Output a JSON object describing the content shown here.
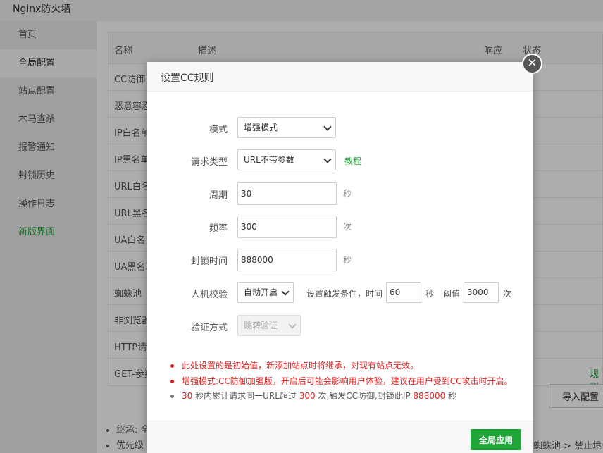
{
  "app": {
    "title": "Nginx防火墙"
  },
  "sidebar": {
    "items": [
      {
        "label": "首页"
      },
      {
        "label": "全局配置"
      },
      {
        "label": "站点配置"
      },
      {
        "label": "木马查杀"
      },
      {
        "label": "报警通知"
      },
      {
        "label": "封锁历史"
      },
      {
        "label": "操作日志"
      },
      {
        "label": "新版界面"
      }
    ]
  },
  "table": {
    "headers": {
      "name": "名称",
      "desc": "描述",
      "response": "响应",
      "status": "状态"
    },
    "rows": [
      {
        "name": "CC防御"
      },
      {
        "name": "恶意容忍"
      },
      {
        "name": "IP白名单"
      },
      {
        "name": "IP黑名单"
      },
      {
        "name": "URL白名单"
      },
      {
        "name": "URL黑名单"
      },
      {
        "name": "UA白名单"
      },
      {
        "name": "UA黑名单"
      },
      {
        "name": "蜘蛛池"
      },
      {
        "name": "非浏览器"
      },
      {
        "name": "HTTP请求"
      },
      {
        "name": "GET-参数"
      }
    ],
    "row_link": "规则",
    "import_label": "导入配置"
  },
  "notes": {
    "items": [
      "继承: 全",
      "优先级"
    ],
    "trail": "蜘蛛池 > 禁止境外"
  },
  "modal": {
    "title": "设置CC规则",
    "close_symbol": "✕",
    "mode": {
      "label": "模式",
      "value": "增强模式"
    },
    "request_type": {
      "label": "请求类型",
      "value": "URL不带参数",
      "tutorial": "教程"
    },
    "period": {
      "label": "周期",
      "value": "30",
      "unit": "秒"
    },
    "frequency": {
      "label": "频率",
      "value": "300",
      "unit": "次"
    },
    "ban_time": {
      "label": "封锁时间",
      "value": "888000",
      "unit": "秒"
    },
    "captcha": {
      "label": "人机校验",
      "value": "自动开启",
      "trigger_prefix": "设置触发条件，时间",
      "time_value": "60",
      "time_unit": "秒",
      "threshold_label": "阈值",
      "threshold_value": "3000",
      "threshold_unit": "次"
    },
    "verify": {
      "label": "验证方式",
      "value": "跳转验证"
    },
    "tips": {
      "tip1": "此处设置的是初始值，新添加站点时将继承，对现有站点无效。",
      "tip2": "增强模式:CC防御加强版，开启后可能会影响用户体验，建议在用户受到CC攻击时开启。",
      "tip3": {
        "period": "30",
        "text_a": " 秒内累计请求同一URL超过 ",
        "count": "300",
        "text_b": " 次,触发CC防御,封锁此IP ",
        "ban": "888000",
        "text_c": " 秒"
      }
    },
    "apply_label": "全局应用"
  },
  "colors": {
    "accent": "#20a53a",
    "warning": "#e02020"
  }
}
